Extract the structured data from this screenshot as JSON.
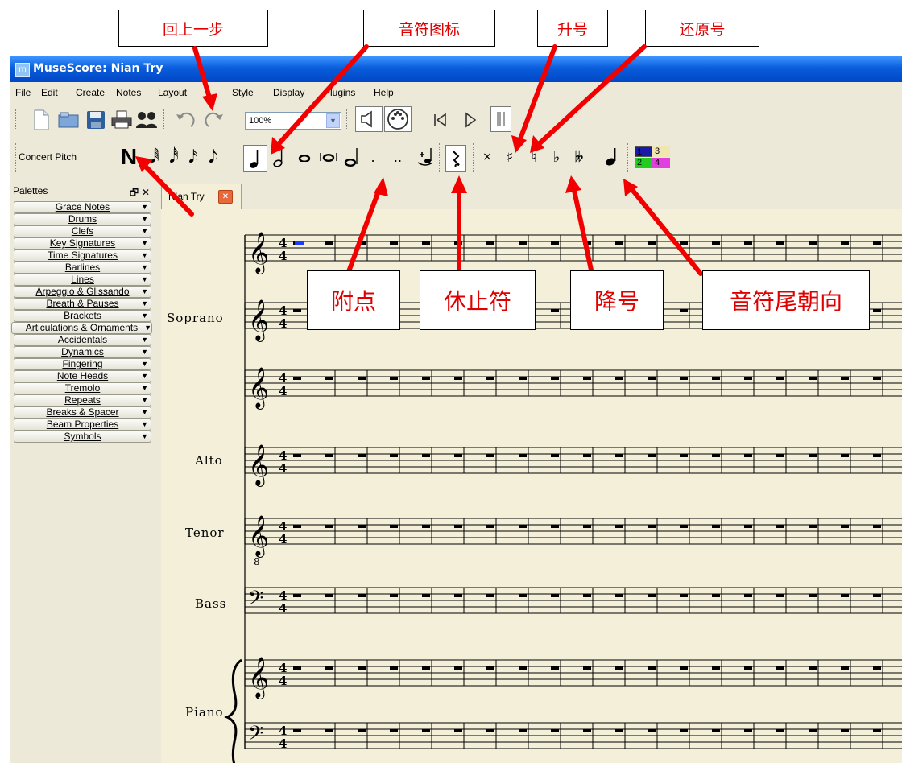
{
  "callouts": {
    "undo": "回上一步",
    "note_icon": "音符图标",
    "sharp": "升号",
    "natural": "还原号",
    "dot": "附点",
    "rest": "休止符",
    "flat": "降号",
    "stem": "音符尾朝向"
  },
  "window": {
    "title": "MuseScore: Nian Try",
    "app_icon": "m"
  },
  "menu": [
    "File",
    "Edit",
    "Create",
    "Notes",
    "Layout",
    "Style",
    "Display",
    "Plugins",
    "Help"
  ],
  "toolbar": {
    "zoom_value": "100%",
    "concert_pitch": "Concert Pitch",
    "note_input": "N",
    "voices": [
      "1",
      "3",
      "2",
      "4"
    ]
  },
  "palettes": {
    "title": "Palettes",
    "items": [
      "Grace Notes",
      "Drums",
      "Clefs",
      "Key Signatures",
      "Time Signatures",
      "Barlines",
      "Lines",
      "Arpeggio & Glissando",
      "Breath & Pauses",
      "Brackets",
      "Articulations & Ornaments",
      "Accidentals",
      "Dynamics",
      "Fingering",
      "Note Heads",
      "Tremolo",
      "Repeats",
      "Breaks & Spacer",
      "Beam Properties",
      "Symbols"
    ]
  },
  "score": {
    "tab_label": "Nian Try",
    "time_signature": [
      "4",
      "4"
    ],
    "instruments": [
      "Soprano",
      "Alto",
      "Tenor",
      "Bass",
      "Piano"
    ],
    "tenor_octave_mark": "8"
  },
  "colors": {
    "arrow": "#f20000",
    "callout_text": "#e00000",
    "title_bar": "#0a5ddc",
    "score_bg": "#f3efd9",
    "voice1": "#1a1aa8",
    "voice2": "#22cc22",
    "voice3": "#f0e6b0",
    "voice4": "#e040e0"
  }
}
